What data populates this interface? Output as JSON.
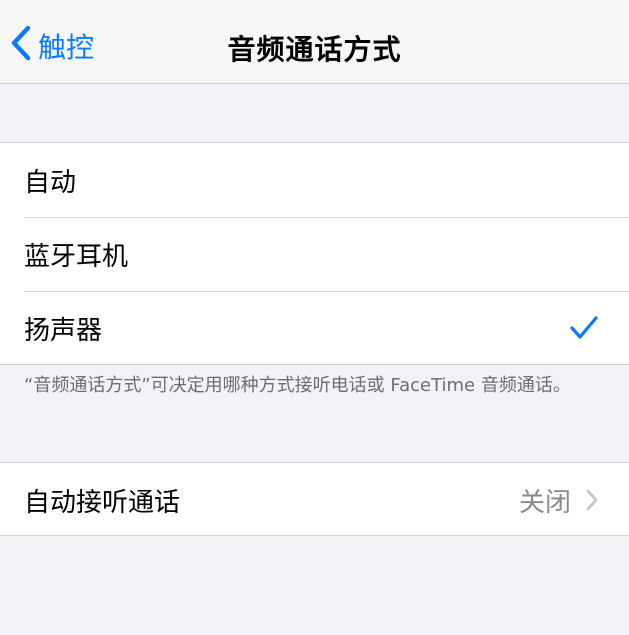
{
  "nav": {
    "back_label": "触控",
    "title": "音频通话方式"
  },
  "audio_routing": {
    "options": [
      {
        "label": "自动",
        "selected": false
      },
      {
        "label": "蓝牙耳机",
        "selected": false
      },
      {
        "label": "扬声器",
        "selected": true
      }
    ],
    "footer": "“音频通话方式”可决定用哪种方式接听电话或 FaceTime 音频通话。"
  },
  "auto_answer": {
    "label": "自动接听通话",
    "value": "关闭"
  },
  "colors": {
    "accent": "#0a7aff",
    "background": "#f2f2f7",
    "secondary_text": "#8a8a8e"
  },
  "icons": {
    "back": "chevron-left-icon",
    "selected": "checkmark-icon",
    "disclosure": "chevron-right-icon"
  }
}
